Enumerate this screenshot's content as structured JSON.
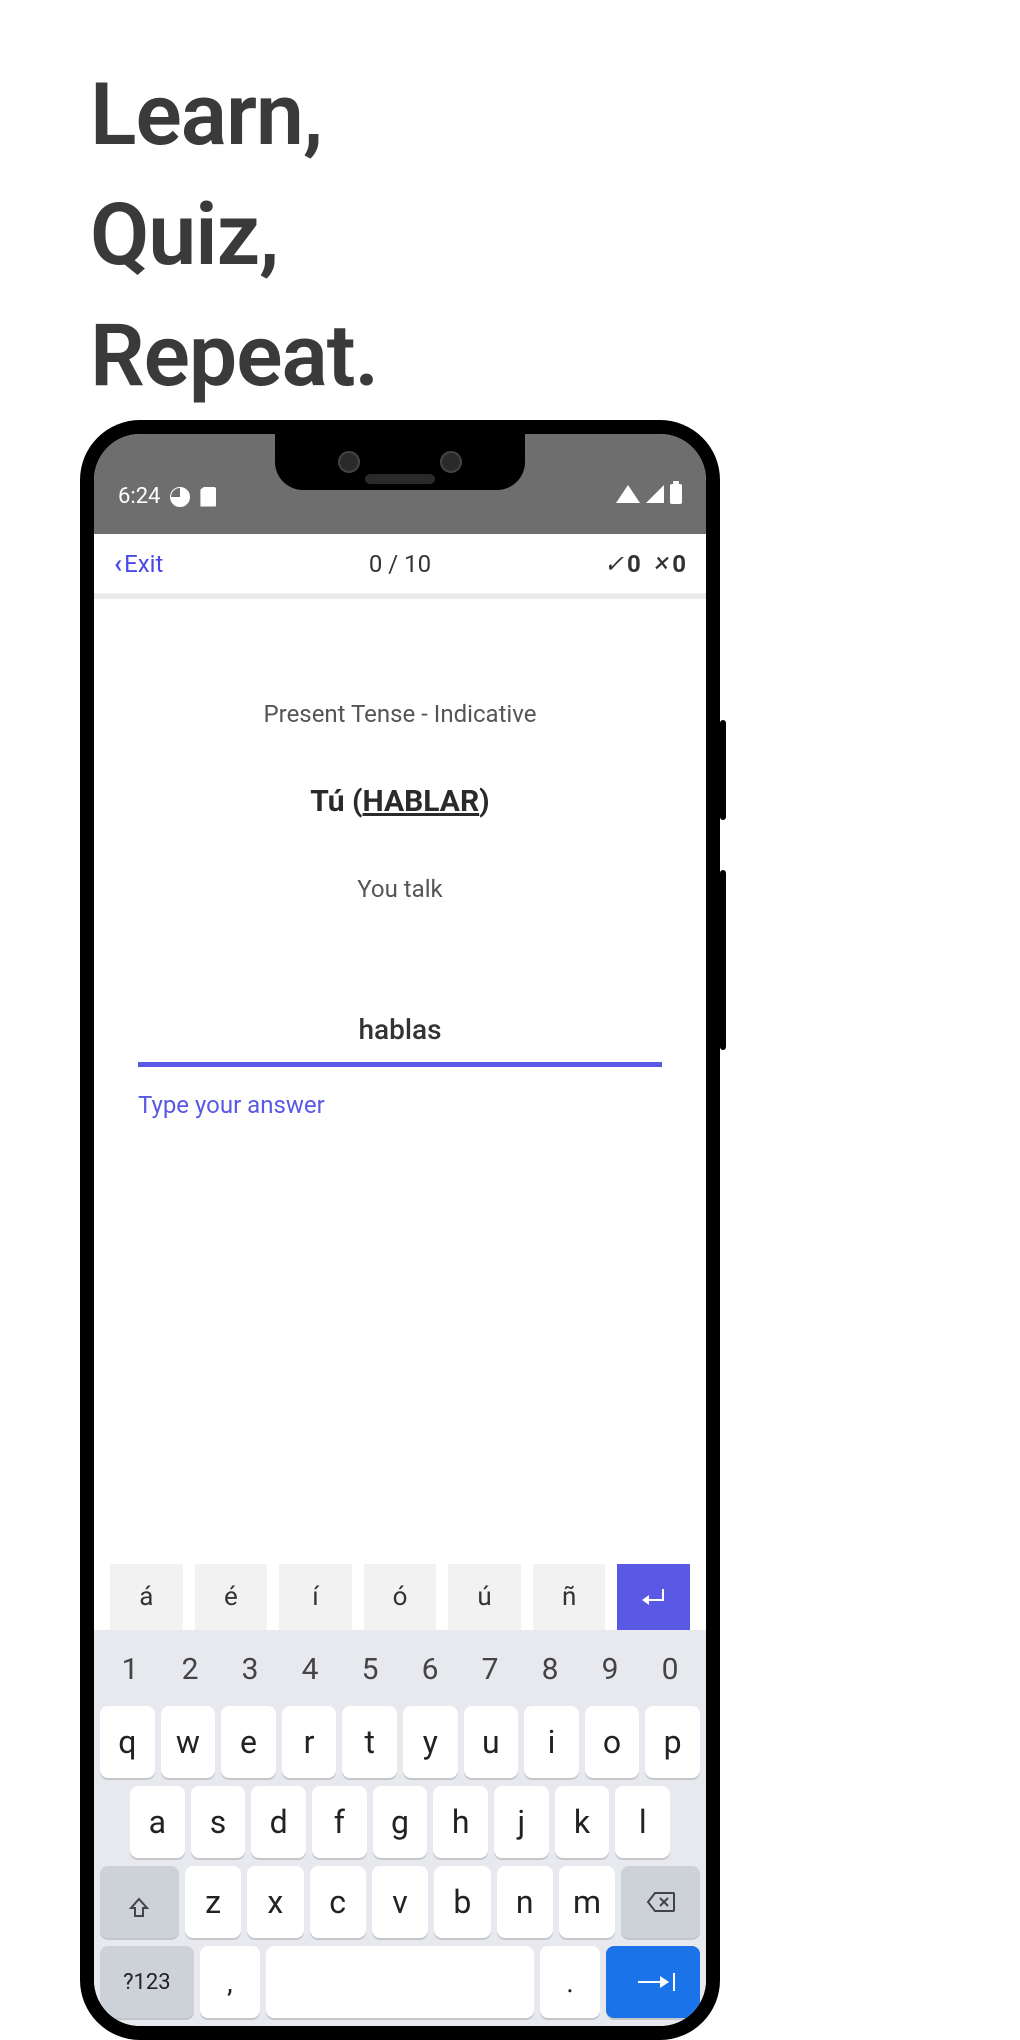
{
  "marketing": {
    "line1": "Learn,",
    "line2": "Quiz,",
    "line3": "Repeat."
  },
  "status_bar": {
    "time": "6:24"
  },
  "header": {
    "exit_label": "Exit",
    "progress": "0 / 10",
    "correct_count": "0",
    "incorrect_count": "0"
  },
  "quiz": {
    "tense": "Present Tense - Indicative",
    "pronoun": "Tú",
    "verb": "HABLAR",
    "translation": "You talk",
    "answer_value": "hablas",
    "hint_label": "Type your answer"
  },
  "accents": {
    "a": "á",
    "e": "é",
    "i": "í",
    "o": "ó",
    "u": "ú",
    "n": "ñ"
  },
  "keyboard": {
    "numbers": [
      "1",
      "2",
      "3",
      "4",
      "5",
      "6",
      "7",
      "8",
      "9",
      "0"
    ],
    "row1": [
      "q",
      "w",
      "e",
      "r",
      "t",
      "y",
      "u",
      "i",
      "o",
      "p"
    ],
    "row2": [
      "a",
      "s",
      "d",
      "f",
      "g",
      "h",
      "j",
      "k",
      "l"
    ],
    "row3": [
      "z",
      "x",
      "c",
      "v",
      "b",
      "n",
      "m"
    ],
    "symbols_label": "?123",
    "comma": ",",
    "period": "."
  }
}
